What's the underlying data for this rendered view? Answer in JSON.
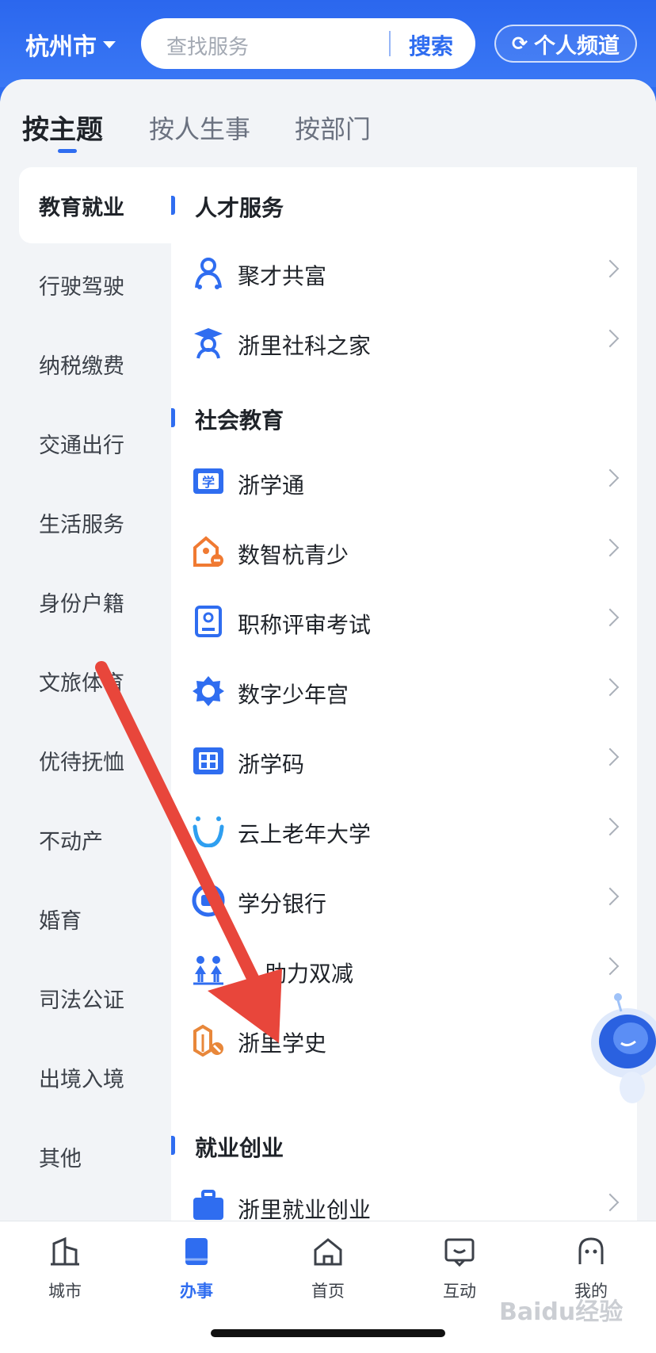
{
  "header": {
    "city": "杭州市",
    "search_placeholder": "查找服务",
    "search_button": "搜索",
    "channel_button": "个人频道"
  },
  "tabs": [
    {
      "label": "按主题",
      "active": true
    },
    {
      "label": "按人生事",
      "active": false
    },
    {
      "label": "按部门",
      "active": false
    }
  ],
  "left_nav": [
    {
      "label": "教育就业",
      "active": true
    },
    {
      "label": "行驶驾驶"
    },
    {
      "label": "纳税缴费"
    },
    {
      "label": "交通出行"
    },
    {
      "label": "生活服务"
    },
    {
      "label": "身份户籍"
    },
    {
      "label": "文旅体育"
    },
    {
      "label": "优待抚恤"
    },
    {
      "label": "不动产"
    },
    {
      "label": "婚育"
    },
    {
      "label": "司法公证"
    },
    {
      "label": "出境入境"
    },
    {
      "label": "其他"
    }
  ],
  "sections": [
    {
      "title": "人才服务",
      "items": [
        {
          "label": "聚才共富",
          "icon": "person-icon"
        },
        {
          "label": "浙里社科之家",
          "icon": "graduate-icon"
        }
      ]
    },
    {
      "title": "社会教育",
      "items": [
        {
          "label": "浙学通",
          "icon": "study-book-icon"
        },
        {
          "label": "数智杭青少",
          "icon": "youth-building-icon"
        },
        {
          "label": "职称评审考试",
          "icon": "id-card-icon"
        },
        {
          "label": "数字少年宫",
          "icon": "palace-badge-icon"
        },
        {
          "label": "浙学码",
          "icon": "qr-book-icon"
        },
        {
          "label": "云上老年大学",
          "icon": "smile-cloud-icon"
        },
        {
          "label": "学分银行",
          "icon": "bank-coin-icon"
        },
        {
          "label": "助力双减",
          "icon": "children-icon"
        },
        {
          "label": "浙里学史",
          "icon": "history-book-icon"
        }
      ]
    },
    {
      "title": "就业创业",
      "items": [
        {
          "label": "浙里就业创业",
          "icon": "briefcase-icon"
        }
      ]
    }
  ],
  "tabbar": [
    {
      "label": "城市",
      "icon": "city-icon"
    },
    {
      "label": "办事",
      "icon": "affairs-icon",
      "active": true
    },
    {
      "label": "首页",
      "icon": "home-icon"
    },
    {
      "label": "互动",
      "icon": "chat-icon"
    },
    {
      "label": "我的",
      "icon": "profile-icon"
    }
  ],
  "watermark": "Baidu经验",
  "colors": {
    "primary": "#2f6df0",
    "arrow": "#e8463b"
  }
}
